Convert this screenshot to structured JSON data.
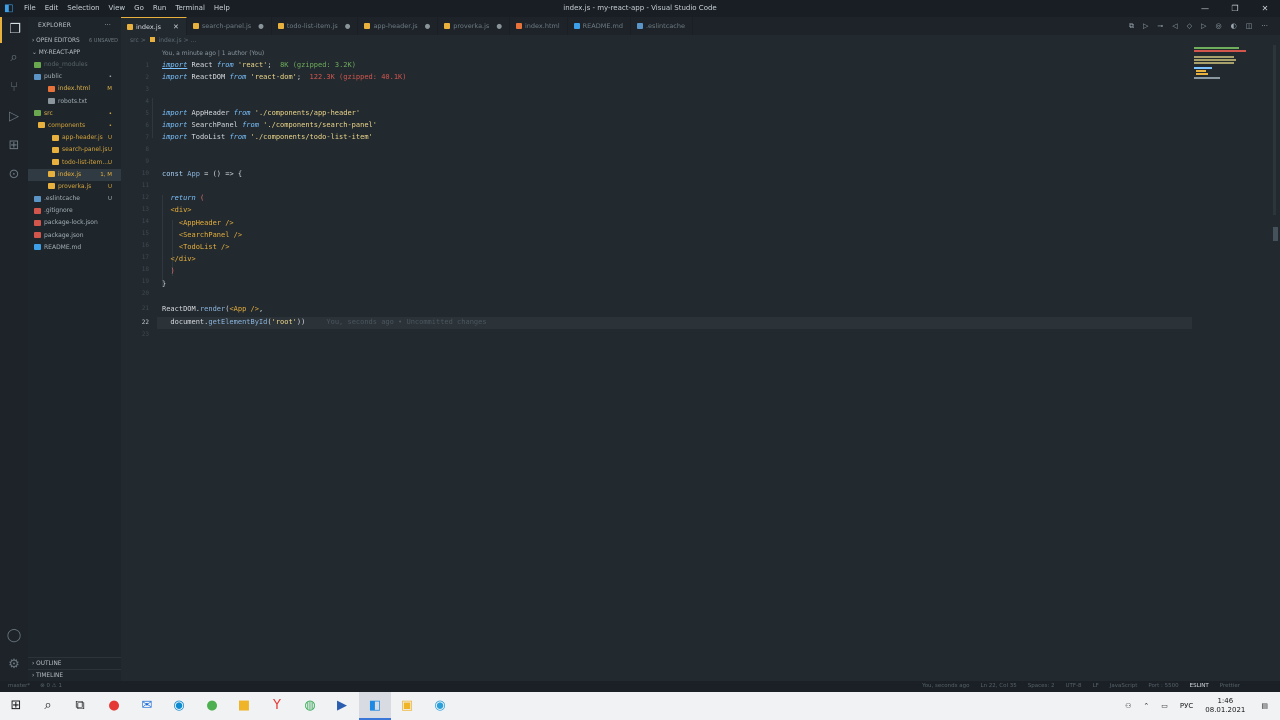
{
  "window": {
    "title": "index.js - my-react-app - Visual Studio Code",
    "menu": [
      "File",
      "Edit",
      "Selection",
      "View",
      "Go",
      "Run",
      "Terminal",
      "Help"
    ],
    "controls": [
      "—",
      "❐",
      "✕"
    ]
  },
  "sidebar": {
    "header": "EXPLORER",
    "header_more": "···",
    "open_editors": {
      "label": "OPEN EDITORS",
      "badge": "6 UNSAVED"
    },
    "project": "MY-REACT-APP",
    "tree": [
      {
        "name": "node_modules",
        "status": "",
        "color": "#56626a",
        "icon": "#6aa84f",
        "selected": false
      },
      {
        "name": "public",
        "status": "•",
        "color": "#a4b0b8",
        "icon": "#5b95c8",
        "selected": false
      },
      {
        "name": "index.html",
        "status": "M",
        "color": "#e2b34a",
        "icon": "#e8733a",
        "selected": false
      },
      {
        "name": "robots.txt",
        "status": "",
        "color": "#a4b0b8",
        "icon": "#8a959c",
        "selected": false
      },
      {
        "name": "src",
        "status": "•",
        "color": "#e2b34a",
        "icon": "#6aa84f",
        "selected": false
      },
      {
        "name": "components",
        "status": "•",
        "color": "#d6a53c",
        "icon": "#e8b03c",
        "selected": false
      },
      {
        "name": "app-header.js",
        "status": "U",
        "color": "#d6a53c",
        "icon": "#e8b03c",
        "selected": false
      },
      {
        "name": "search-panel.js",
        "status": "U",
        "color": "#d6a53c",
        "icon": "#e8b03c",
        "selected": false
      },
      {
        "name": "todo-list-item....",
        "status": "U",
        "color": "#d6a53c",
        "icon": "#e8b03c",
        "selected": false
      },
      {
        "name": "index.js",
        "status": "1, M",
        "color": "#e8b03c",
        "icon": "#e8b03c",
        "selected": true
      },
      {
        "name": "proverka.js",
        "status": "U",
        "color": "#d6a53c",
        "icon": "#e8b03c",
        "selected": false
      },
      {
        "name": ".eslintcache",
        "status": "U",
        "color": "#a4b0b8",
        "icon": "#5b95c8",
        "selected": false
      },
      {
        "name": ".gitignore",
        "status": "",
        "color": "#a4b0b8",
        "icon": "#d3564d",
        "selected": false
      },
      {
        "name": "package-lock.json",
        "status": "",
        "color": "#a4b0b8",
        "icon": "#d3564d",
        "selected": false
      },
      {
        "name": "package.json",
        "status": "",
        "color": "#a4b0b8",
        "icon": "#d3564d",
        "selected": false
      },
      {
        "name": "README.md",
        "status": "",
        "color": "#a4b0b8",
        "icon": "#3c9fe8",
        "selected": false
      }
    ],
    "outline": "OUTLINE",
    "timeline": "TIMELINE"
  },
  "tabs": [
    {
      "label": "index.js",
      "active": true,
      "icon": "#e8b03c",
      "close": "✕"
    },
    {
      "label": "search-panel.js",
      "active": false,
      "icon": "#e8b03c",
      "close": "●"
    },
    {
      "label": "todo-list-item.js",
      "active": false,
      "icon": "#e8b03c",
      "close": "●"
    },
    {
      "label": "app-header.js",
      "active": false,
      "icon": "#e8b03c",
      "close": "●"
    },
    {
      "label": "proverka.js",
      "active": false,
      "icon": "#e8b03c",
      "close": "●"
    },
    {
      "label": "index.html",
      "active": false,
      "icon": "#e8733a",
      "close": ""
    },
    {
      "label": "README.md",
      "active": false,
      "icon": "#3c9fe8",
      "close": ""
    },
    {
      "label": ".eslintcache",
      "active": false,
      "icon": "#5b95c8",
      "close": ""
    }
  ],
  "breadcrumb": {
    "folder": "src",
    "sep": ">",
    "file": "index.js",
    "more": "> ..."
  },
  "codelens": "You, a minute ago | 1 author (You)",
  "editor": {
    "current_line": 22,
    "blame": "You, seconds ago • Uncommitted changes"
  },
  "statusbar": {
    "left": [
      "master*",
      "⊗ 0 ⚠ 1"
    ],
    "right": [
      "You, seconds ago",
      "Ln 22, Col 35",
      "Spaces: 2",
      "UTF-8",
      "LF",
      "JavaScript",
      "Port : 5500",
      "ESLINT",
      "Prettier"
    ]
  },
  "taskbar": {
    "apps": [
      "windows-start",
      "search",
      "task-view",
      "yandex-browser",
      "mail",
      "edge",
      "utorrent",
      "file-explorer",
      "yandex",
      "chrome",
      "powershell",
      "vscode",
      "media-player",
      "telegram"
    ],
    "tray_lang": "РУС",
    "time": "1:46",
    "date": "08.01.2021"
  },
  "colors": {
    "accent": "#e8b03c",
    "background": "#22292f",
    "sidebar": "#1f262b"
  }
}
